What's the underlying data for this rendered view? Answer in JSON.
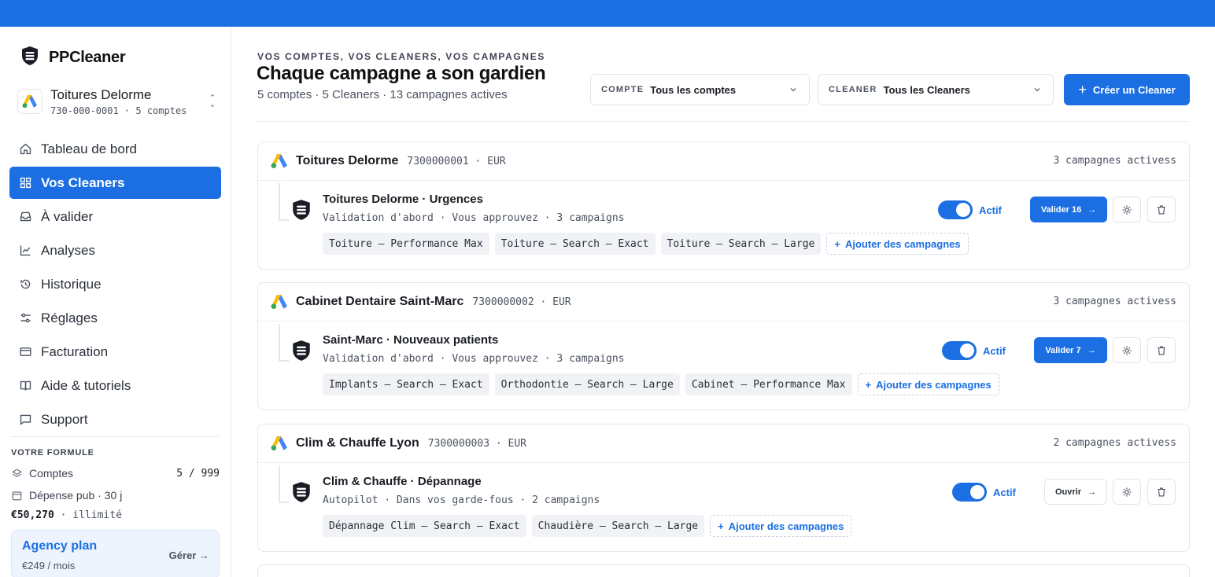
{
  "app": {
    "name": "PPCleaner"
  },
  "account": {
    "name": "Toitures Delorme",
    "sub": "730-000-0001 · 5 comptes"
  },
  "nav": [
    {
      "label": "Tableau de bord",
      "icon": "home-icon",
      "active": false
    },
    {
      "label": "Vos Cleaners",
      "icon": "grid-icon",
      "active": true
    },
    {
      "label": "À valider",
      "icon": "inbox-icon",
      "active": false
    },
    {
      "label": "Analyses",
      "icon": "chart-line-icon",
      "active": false
    },
    {
      "label": "Historique",
      "icon": "history-icon",
      "active": false
    },
    {
      "label": "Réglages",
      "icon": "sliders-icon",
      "active": false
    },
    {
      "label": "Facturation",
      "icon": "credit-card-icon",
      "active": false
    },
    {
      "label": "Aide & tutoriels",
      "icon": "book-icon",
      "active": false
    },
    {
      "label": "Support",
      "icon": "message-icon",
      "active": false
    }
  ],
  "plan": {
    "title": "VOTRE FORMULE",
    "accounts_label": "Comptes",
    "accounts_value": "5 / 999",
    "spend_label": "Dépense pub · 30 j",
    "spend_value": "€50,270",
    "spend_limit": "· illimité",
    "agency_name": "Agency plan",
    "agency_price": "€249 / mois",
    "manage_label": "Gérer"
  },
  "header": {
    "eyebrow": "VOS COMPTES, VOS CLEANERS, VOS CAMPAGNES",
    "title": "Chaque campagne a son gardien",
    "subtitle": "5 comptes · 5 Cleaners · 13 campagnes actives"
  },
  "filters": {
    "account_key": "COMPTE",
    "account_value": "Tous les comptes",
    "cleaner_key": "CLEANER",
    "cleaner_value": "Tous les Cleaners",
    "create_label": "Créer un Cleaner"
  },
  "accounts": [
    {
      "name": "Toitures Delorme",
      "id": "7300000001 · EUR",
      "count": "3 campagnes activess",
      "cleaner": {
        "name": "Toitures Delorme · Urgences",
        "meta": "Validation d'abord · Vous approuvez · 3 campaigns",
        "status": "Actif",
        "action": "Valider 16",
        "campaigns": [
          "Toiture — Performance Max",
          "Toiture — Search — Exact",
          "Toiture — Search — Large"
        ]
      }
    },
    {
      "name": "Cabinet Dentaire Saint-Marc",
      "id": "7300000002 · EUR",
      "count": "3 campagnes activess",
      "cleaner": {
        "name": "Saint-Marc · Nouveaux patients",
        "meta": "Validation d'abord · Vous approuvez · 3 campaigns",
        "status": "Actif",
        "action": "Valider 7",
        "campaigns": [
          "Implants — Search — Exact",
          "Orthodontie — Search — Large",
          "Cabinet — Performance Max"
        ]
      }
    },
    {
      "name": "Clim & Chauffe Lyon",
      "id": "7300000003 · EUR",
      "count": "2 campagnes activess",
      "cleaner": {
        "name": "Clim & Chauffe · Dépannage",
        "meta": "Autopilot · Dans vos garde-fous · 2 campaigns",
        "status": "Actif",
        "action": "Ouvrir",
        "campaigns": [
          "Dépannage Clim — Search — Exact",
          "Chaudière — Search — Large"
        ]
      }
    }
  ],
  "add_campaigns_label": "Ajouter des campagnes",
  "colors": {
    "primary": "#1b6fe3",
    "text": "#1a1d24",
    "muted": "#4b5260"
  }
}
